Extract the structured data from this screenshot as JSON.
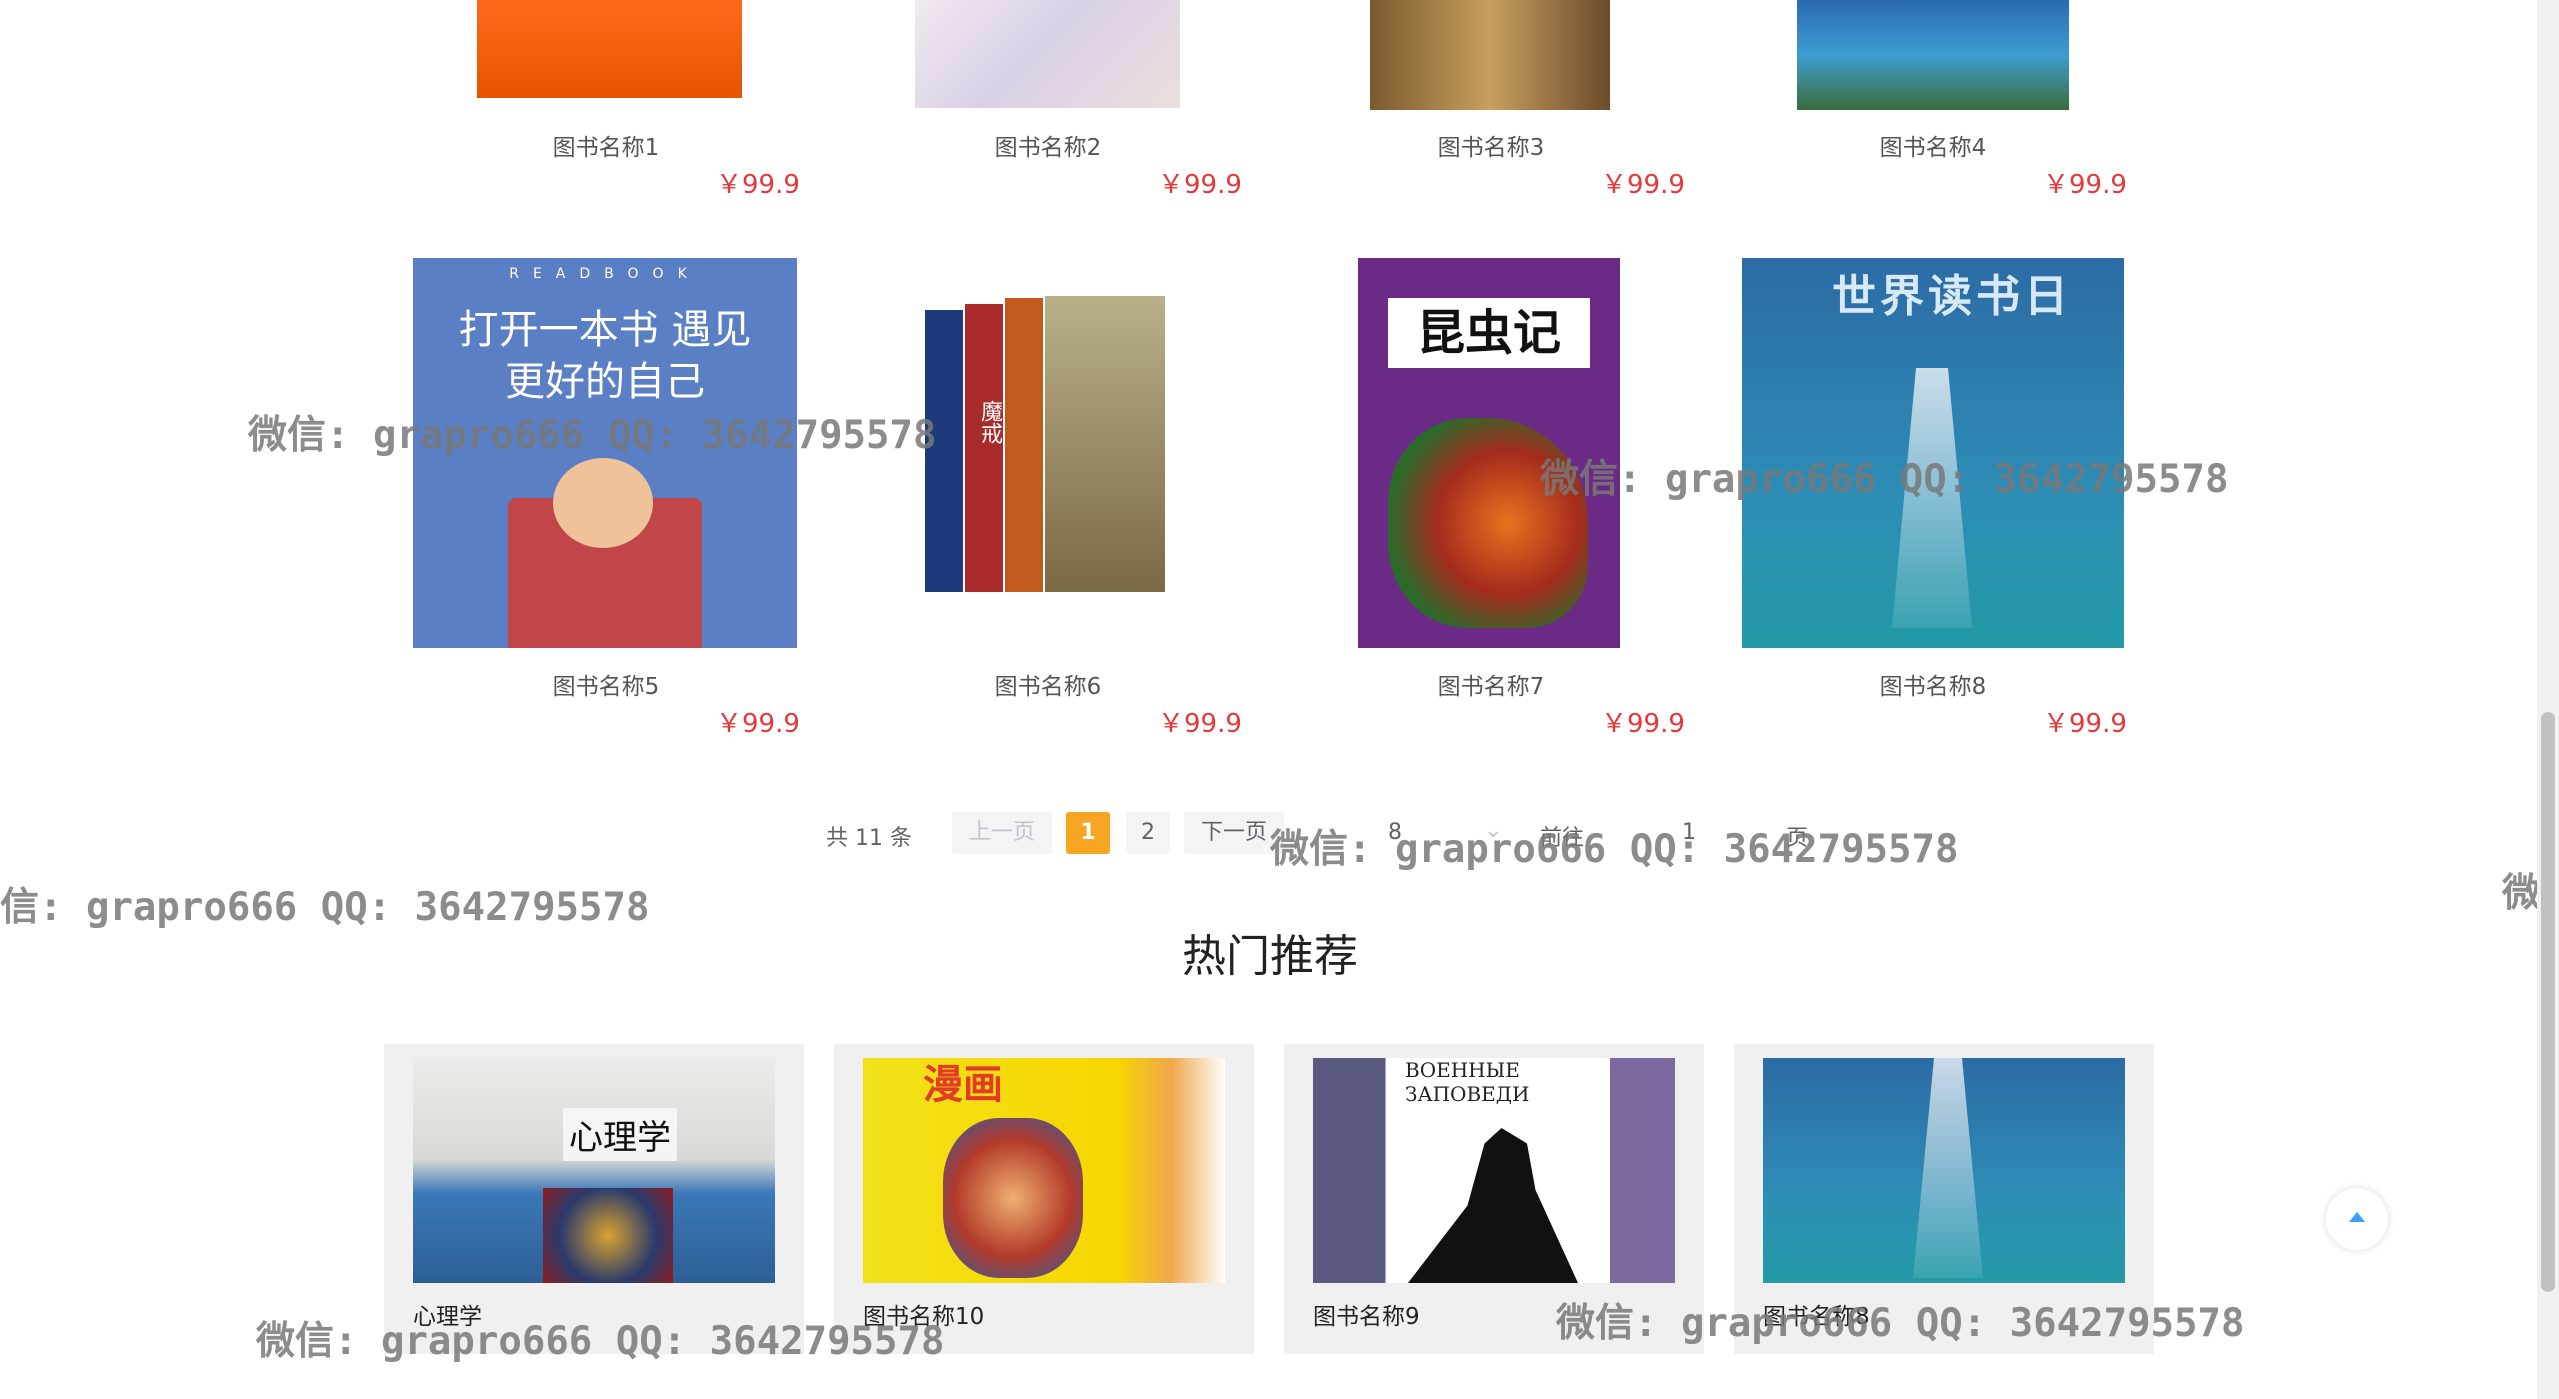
{
  "books": [
    {
      "title": "图书名称1",
      "price": "￥99.9"
    },
    {
      "title": "图书名称2",
      "price": "￥99.9"
    },
    {
      "title": "图书名称3",
      "price": "￥99.9"
    },
    {
      "title": "图书名称4",
      "price": "￥99.9"
    },
    {
      "title": "图书名称5",
      "price": "￥99.9",
      "cover_text": "打开一本书 遇见更好的自己",
      "cover_top": "READBOOK"
    },
    {
      "title": "图书名称6",
      "price": "￥99.9",
      "cover_text": "魔戒"
    },
    {
      "title": "图书名称7",
      "price": "￥99.9",
      "cover_text": "昆虫记"
    },
    {
      "title": "图书名称8",
      "price": "￥99.9",
      "cover_text": "世界读书日"
    }
  ],
  "pagination": {
    "total": "共 11 条",
    "prev": "上一页",
    "pages": [
      "1",
      "2"
    ],
    "current": "1",
    "next": "下一页",
    "page_size": "8",
    "goto_label": "前往",
    "goto_value": "1",
    "goto_suffix": "页"
  },
  "hot": {
    "title": "热门推荐",
    "items": [
      {
        "label": "心理学",
        "cover_text": "心理学"
      },
      {
        "label": "图书名称10",
        "cover_text": "漫画"
      },
      {
        "label": "图书名称9",
        "cover_text": "ВОЕННЫЕ ЗАПОВЕДИ"
      },
      {
        "label": "图书名称8"
      }
    ]
  },
  "watermark": "微信: grapro666 QQ: 3642795578",
  "watermark_edge_left": "信: grapro666 QQ: 3642795578",
  "watermark_edge_right": "微",
  "colors": {
    "price": "#e4393c",
    "pager_active": "#f6a623"
  },
  "icons": {
    "back_to_top": "caret-up-icon",
    "page_size_dropdown": "chevron-down-icon"
  }
}
